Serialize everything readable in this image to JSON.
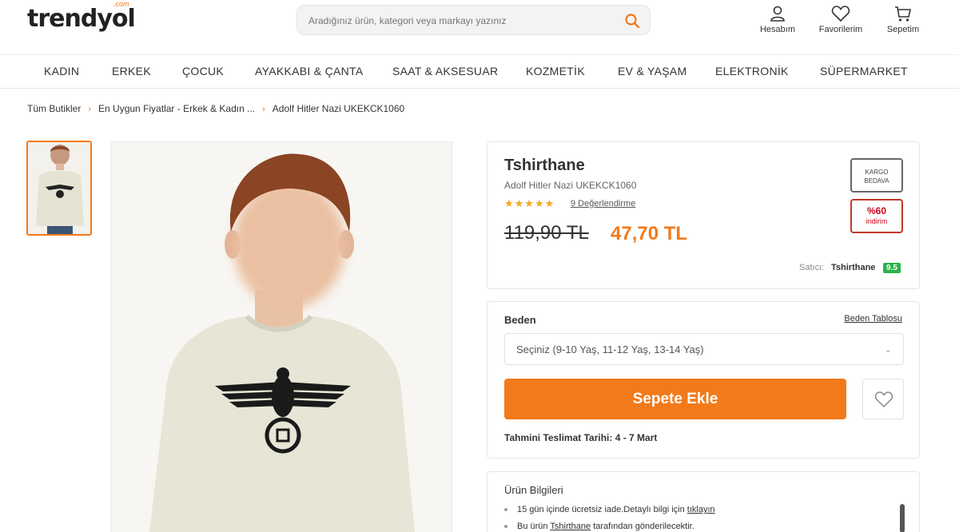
{
  "header": {
    "logo": "trendyol",
    "logo_suffix": ".com",
    "search_placeholder": "Aradığınız ürün, kategori veya markayı yazınız",
    "account_label": "Hesabım",
    "favorites_label": "Favorilerim",
    "cart_label": "Sepetim"
  },
  "nav": {
    "items": [
      "KADIN",
      "ERKEK",
      "ÇOCUK",
      "AYAKKABI & ÇANTA",
      "SAAT & AKSESUAR",
      "KOZMETİK",
      "EV & YAŞAM",
      "ELEKTRONİK",
      "SÜPERMARKET"
    ]
  },
  "breadcrumb": {
    "items": [
      "Tüm Butikler",
      "En Uygun Fiyatlar - Erkek & Kadın ...",
      "Adolf Hitler Nazi UKEKCK1060"
    ]
  },
  "product": {
    "brand": "Tshirthane",
    "name": "Adolf Hitler Nazi UKEKCK1060",
    "rating_stars": "★★★★★",
    "rating": 5,
    "reviews_link": "9 Değerlendirme",
    "old_price": "119,90 TL",
    "new_price": "47,70 TL",
    "badge_kargo_line1": "KARGO",
    "badge_kargo_line2": "BEDAVA",
    "badge_discount_pct": "%60",
    "badge_discount_label": "indirim",
    "seller_label": "Satıcı:",
    "seller_name": "Tshirthane",
    "seller_score": "9.5"
  },
  "purchase": {
    "size_label": "Beden",
    "size_table_link": "Beden Tablosu",
    "size_select_value": "Seçiniz (9-10 Yaş, 11-12 Yaş, 13-14 Yaş)",
    "add_to_cart": "Sepete Ekle",
    "delivery_label": "Tahmini Teslimat Tarihi:",
    "delivery_value": "4 - 7 Mart"
  },
  "info": {
    "title": "Ürün Bilgileri",
    "item1_text": "15 gün içinde ücretsiz iade.Detaylı bilgi için ",
    "item1_link": "tıklayın",
    "item2_pre": "Bu ürün ",
    "item2_link": "Tshirthane",
    "item2_post": " tarafından gönderilecektir."
  },
  "colors": {
    "accent": "#f27a1a",
    "discount": "#d0021b",
    "seller_score": "#29b34a"
  }
}
